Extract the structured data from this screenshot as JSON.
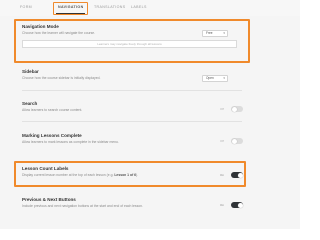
{
  "tabs": [
    {
      "label": "FORM",
      "active": false
    },
    {
      "label": "NAVIGATION",
      "active": true
    },
    {
      "label": "TRANSLATIONS",
      "active": false
    },
    {
      "label": "LABELS",
      "active": false
    }
  ],
  "accent_color": "#f08a2c",
  "settings": {
    "navigation_mode": {
      "title": "Navigation Mode",
      "description": "Choose how the learner will navigate the course.",
      "value": "Free",
      "hint": "Learners may navigate freely through all lessons"
    },
    "sidebar": {
      "title": "Sidebar",
      "description": "Choose how the course sidebar is initially displayed.",
      "value": "Open"
    },
    "search": {
      "title": "Search",
      "description": "Allow learners to search course content.",
      "toggle_label": "Off",
      "enabled": false
    },
    "marking_complete": {
      "title": "Marking Lessons Complete",
      "description": "Allow learners to mark lessons as complete in the sidebar menu.",
      "toggle_label": "Off",
      "enabled": false
    },
    "lesson_count_labels": {
      "title": "Lesson Count Labels",
      "description_prefix": "Display current lesson number at the top of each lesson (e.g. ",
      "description_example": "Lesson 1 of 6",
      "description_suffix": ").",
      "toggle_label": "On",
      "enabled": true
    },
    "prev_next_buttons": {
      "title": "Previous & Next Buttons",
      "description": "Include previous and next navigation buttons at the start and end of each lesson.",
      "toggle_label": "On",
      "enabled": true
    }
  }
}
